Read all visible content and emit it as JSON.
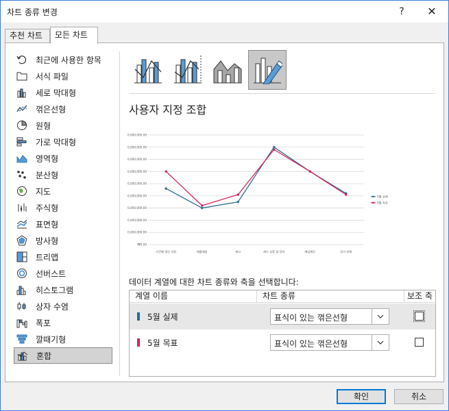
{
  "window": {
    "title": "차트 종류 변경",
    "help_label": "?",
    "close_label": "✕"
  },
  "tabs": [
    {
      "label": "추천 차트"
    },
    {
      "label": "모든 차트",
      "selected": true
    }
  ],
  "sidebar": {
    "items": [
      {
        "label": "최근에 사용한 항목",
        "icon": "recent-icon"
      },
      {
        "label": "서식 파일",
        "icon": "folder-icon"
      },
      {
        "label": "세로 막대형",
        "icon": "column-chart-icon"
      },
      {
        "label": "꺾은선형",
        "icon": "line-chart-icon"
      },
      {
        "label": "원형",
        "icon": "pie-chart-icon"
      },
      {
        "label": "가로 막대형",
        "icon": "bar-chart-icon"
      },
      {
        "label": "영역형",
        "icon": "area-chart-icon"
      },
      {
        "label": "분산형",
        "icon": "scatter-chart-icon"
      },
      {
        "label": "지도",
        "icon": "map-chart-icon"
      },
      {
        "label": "주식형",
        "icon": "stock-chart-icon"
      },
      {
        "label": "표면형",
        "icon": "surface-chart-icon"
      },
      {
        "label": "방사형",
        "icon": "radar-chart-icon"
      },
      {
        "label": "트리맵",
        "icon": "treemap-chart-icon"
      },
      {
        "label": "선버스트",
        "icon": "sunburst-chart-icon"
      },
      {
        "label": "히스토그램",
        "icon": "histogram-chart-icon"
      },
      {
        "label": "상자 수염",
        "icon": "box-whisker-chart-icon"
      },
      {
        "label": "폭포",
        "icon": "waterfall-chart-icon"
      },
      {
        "label": "깔때기형",
        "icon": "funnel-chart-icon"
      },
      {
        "label": "혼합",
        "icon": "combo-chart-icon",
        "selected": true
      }
    ]
  },
  "subtypes": [
    {
      "icon": "clustered-column-line-icon"
    },
    {
      "icon": "clustered-column-line-secondary-axis-icon"
    },
    {
      "icon": "stacked-area-clustered-column-icon"
    },
    {
      "icon": "custom-combination-icon",
      "selected": true
    }
  ],
  "section_title": "사용자 지정 조합",
  "chart_data": {
    "type": "line",
    "categories": [
      "기간별 생산 과정",
      "매출채권",
      "재고",
      "레드 상품 및 장비",
      "매입채무",
      "장기 부채"
    ],
    "series": [
      {
        "name": "5월 실제",
        "color": "#2e6f8e",
        "values": [
          46000000,
          30000000,
          35000000,
          80000000,
          60000000,
          42000000
        ]
      },
      {
        "name": "5월 목표",
        "color": "#d6245e",
        "values": [
          60000000,
          32000000,
          41000000,
          78000000,
          60000000,
          41000000
        ]
      }
    ],
    "ylim": [
      0,
      90000000
    ],
    "yticks": [
      "₩0.00",
      "₩10,000,000.00",
      "₩20,000,000.00",
      "₩30,000,000.00",
      "₩40,000,000.00",
      "₩50,000,000.00",
      "₩60,000,000.00",
      "₩70,000,000.00",
      "₩80,000,000.00",
      "₩90,000,000.00"
    ],
    "grid": true,
    "legend": "right"
  },
  "series_section": {
    "label": "데이터 계열에 대한 차트 종류와 축을 선택합니다:",
    "headers": {
      "name": "계열 이름",
      "type": "차트 종류",
      "axis": "보조 축"
    },
    "rows": [
      {
        "name": "5월 실제",
        "color": "#1f6f9a",
        "chart_type": "표식이 있는 꺾은선형",
        "secondary_axis": false
      },
      {
        "name": "5월 목표",
        "color": "#d6245e",
        "chart_type": "표식이 있는 꺾은선형",
        "secondary_axis": false
      }
    ]
  },
  "buttons": {
    "ok": "확인",
    "cancel": "취소"
  }
}
